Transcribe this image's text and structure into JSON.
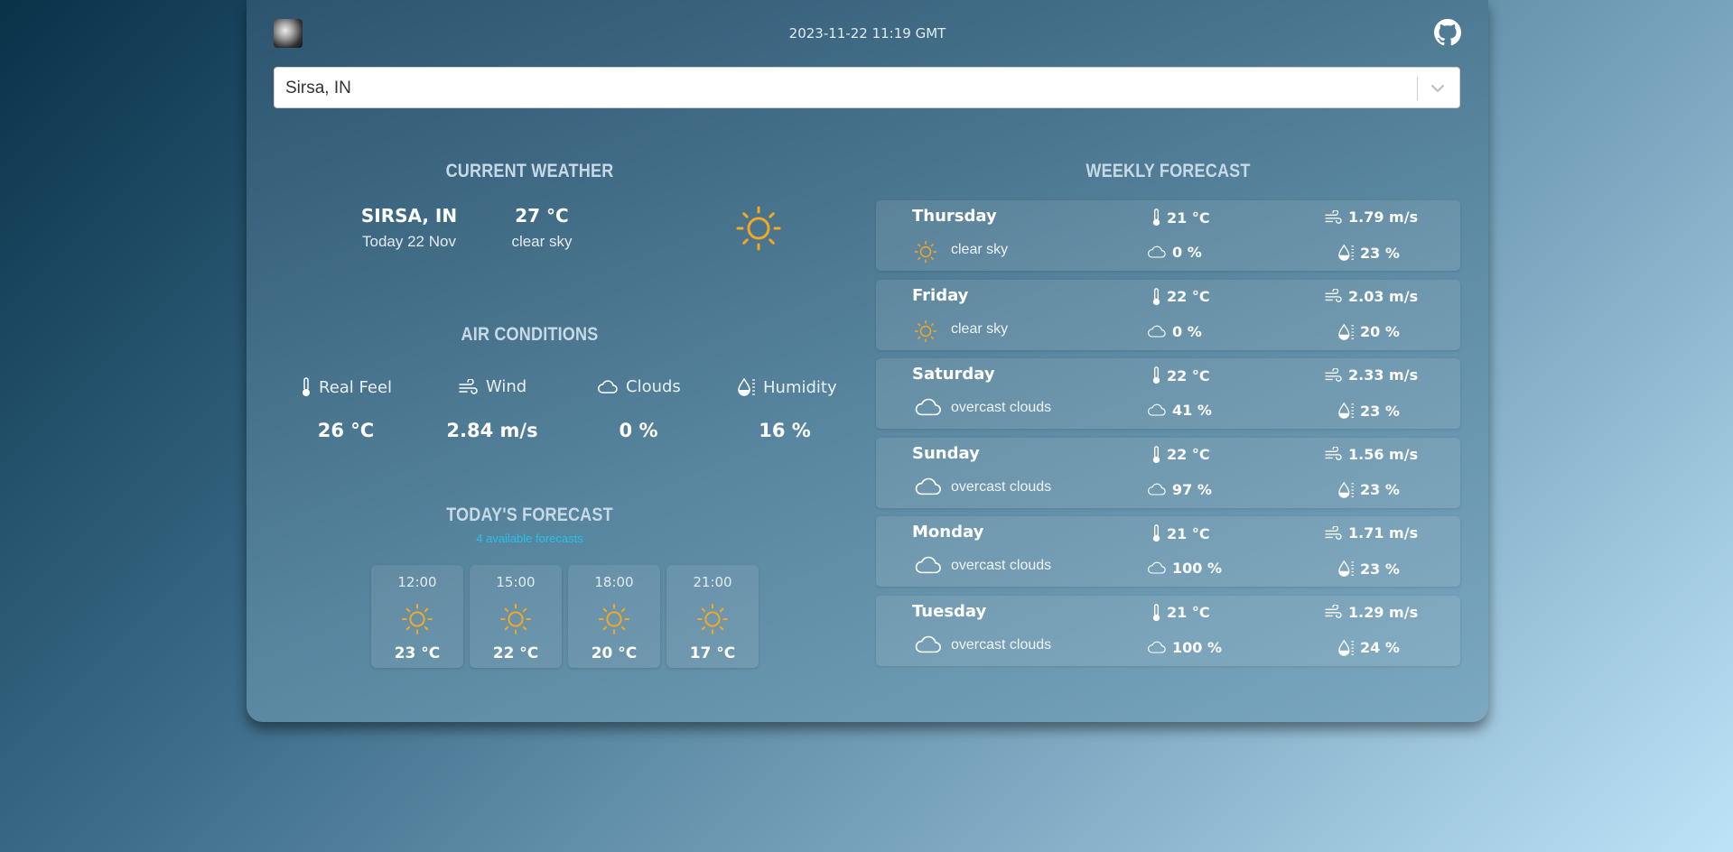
{
  "header": {
    "datetime": "2023-11-22 11:19 GMT",
    "logo_icon": "moon-logo-icon",
    "github_icon": "github-icon"
  },
  "search": {
    "value": "Sirsa, IN"
  },
  "current_weather": {
    "title": "CURRENT WEATHER",
    "city": "SIRSA, IN",
    "date": "Today 22 Nov",
    "temp": "27 °C",
    "description": "clear sky",
    "icon": "sun-icon"
  },
  "air_conditions": {
    "title": "AIR CONDITIONS",
    "items": [
      {
        "label": "Real Feel",
        "value": "26 °C",
        "icon": "thermometer-icon"
      },
      {
        "label": "Wind",
        "value": "2.84 m/s",
        "icon": "wind-icon"
      },
      {
        "label": "Clouds",
        "value": "0 %",
        "icon": "cloud-icon"
      },
      {
        "label": "Humidity",
        "value": "16 %",
        "icon": "humidity-icon"
      }
    ]
  },
  "todays_forecast": {
    "title": "TODAY'S FORECAST",
    "subtitle": "4 available forecasts",
    "items": [
      {
        "time": "12:00",
        "temp": "23 °C",
        "icon": "sun-icon"
      },
      {
        "time": "15:00",
        "temp": "22 °C",
        "icon": "sun-icon"
      },
      {
        "time": "18:00",
        "temp": "20 °C",
        "icon": "sun-icon"
      },
      {
        "time": "21:00",
        "temp": "17 °C",
        "icon": "sun-icon"
      }
    ]
  },
  "weekly_forecast": {
    "title": "WEEKLY FORECAST",
    "days": [
      {
        "day": "Thursday",
        "temp": "21 °C",
        "wind": "1.79 m/s",
        "description": "clear sky",
        "clouds": "0 %",
        "humidity": "23 %",
        "icon": "sun-icon"
      },
      {
        "day": "Friday",
        "temp": "22 °C",
        "wind": "2.03 m/s",
        "description": "clear sky",
        "clouds": "0 %",
        "humidity": "20 %",
        "icon": "sun-icon"
      },
      {
        "day": "Saturday",
        "temp": "22 °C",
        "wind": "2.33 m/s",
        "description": "overcast clouds",
        "clouds": "41 %",
        "humidity": "23 %",
        "icon": "cloud-icon"
      },
      {
        "day": "Sunday",
        "temp": "22 °C",
        "wind": "1.56 m/s",
        "description": "overcast clouds",
        "clouds": "97 %",
        "humidity": "23 %",
        "icon": "cloud-icon"
      },
      {
        "day": "Monday",
        "temp": "21 °C",
        "wind": "1.71 m/s",
        "description": "overcast clouds",
        "clouds": "100 %",
        "humidity": "23 %",
        "icon": "cloud-icon"
      },
      {
        "day": "Tuesday",
        "temp": "21 °C",
        "wind": "1.29 m/s",
        "description": "overcast clouds",
        "clouds": "100 %",
        "humidity": "24 %",
        "icon": "cloud-icon"
      }
    ]
  },
  "colors": {
    "sun": "#f5a623",
    "accent": "#25c1e6"
  }
}
